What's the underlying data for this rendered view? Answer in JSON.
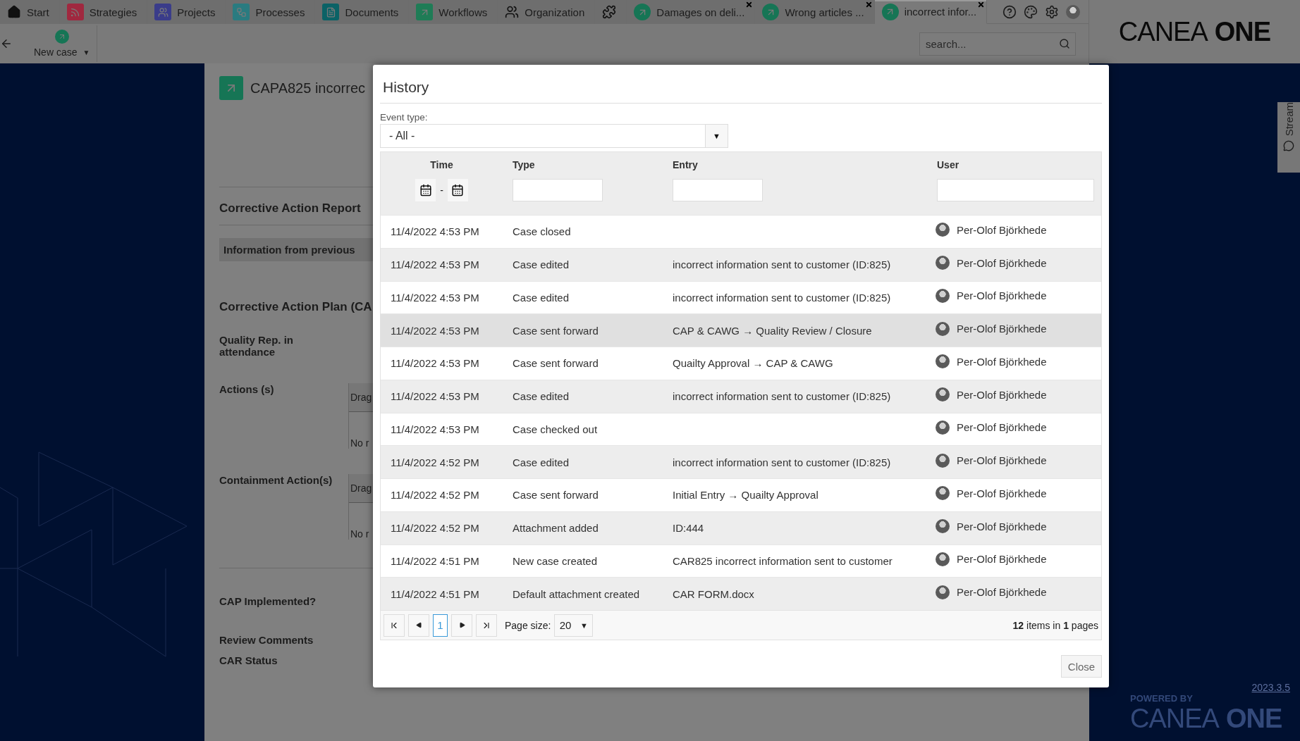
{
  "nav_tabs": [
    {
      "kind": "module",
      "label": "Start",
      "selected": false,
      "closable": false
    },
    {
      "kind": "module",
      "label": "Strategies",
      "selected": false,
      "closable": false
    },
    {
      "kind": "module",
      "label": "Projects",
      "selected": false,
      "closable": false
    },
    {
      "kind": "module",
      "label": "Processes",
      "selected": false,
      "closable": false
    },
    {
      "kind": "module",
      "label": "Documents",
      "selected": false,
      "closable": false
    },
    {
      "kind": "module",
      "label": "Workflows",
      "selected": false,
      "closable": false
    },
    {
      "kind": "module",
      "label": "Organization",
      "selected": false,
      "closable": false
    },
    {
      "kind": "icon",
      "selected": false,
      "closable": false
    },
    {
      "kind": "case",
      "label": "Damages on deli...",
      "selected": false,
      "closable": true
    },
    {
      "kind": "case",
      "label": "Wrong articles ...",
      "selected": false,
      "closable": true
    },
    {
      "kind": "case",
      "label": "incorrect infor...",
      "selected": true,
      "closable": true
    }
  ],
  "toolbar": {
    "new_case": "New case",
    "new_case_caret": "▼",
    "search": {
      "placeholder": "search..."
    }
  },
  "brand": {
    "logo_light": "CANEA",
    "logo_bold": "ONE"
  },
  "footer": {
    "version": "2023.3.5",
    "powered_by": "POWERED BY",
    "logo_light": "CANEA",
    "logo_bold": "ONE"
  },
  "stream_tab": "Stream",
  "case": {
    "title": "CAPA825 incorrec",
    "report_heading": "Corrective Action Report",
    "info_bar": "Information from previous",
    "plan_heading": "Corrective Action Plan (CA",
    "fields": [
      {
        "kind": "label",
        "label": "Quality Rep. in attendance"
      },
      {
        "kind": "grid",
        "label": "Actions (s)",
        "drag": "Drag",
        "empty": "No r"
      },
      {
        "kind": "grid",
        "label": "Containment Action(s)",
        "drag": "Drag",
        "empty": "No r"
      }
    ],
    "bottom_fields": [
      "CAP Implemented?",
      "Review Comments",
      "CAR Status"
    ]
  },
  "dialog": {
    "title": "History",
    "event_type_label": "Event type:",
    "event_type": "- All -",
    "event_type_caret": "▼",
    "columns": [
      "Time",
      "Type",
      "Entry",
      "User"
    ],
    "range_separator": "-",
    "rows": [
      {
        "time": "11/4/2022 4:53 PM",
        "type": "Case closed",
        "entry": "",
        "user": "Per-Olof Björkhede",
        "hovered": false
      },
      {
        "time": "11/4/2022 4:53 PM",
        "type": "Case edited",
        "entry": "incorrect information sent to customer (ID:825)",
        "user": "Per-Olof Björkhede",
        "hovered": false
      },
      {
        "time": "11/4/2022 4:53 PM",
        "type": "Case edited",
        "entry": "incorrect information sent to customer (ID:825)",
        "user": "Per-Olof Björkhede",
        "hovered": false
      },
      {
        "time": "11/4/2022 4:53 PM",
        "type": "Case sent forward",
        "entry": "CAP & CAWG → Quality Review / Closure",
        "user": "Per-Olof Björkhede",
        "hovered": true
      },
      {
        "time": "11/4/2022 4:53 PM",
        "type": "Case sent forward",
        "entry": "Quailty Approval → CAP & CAWG",
        "user": "Per-Olof Björkhede",
        "hovered": false
      },
      {
        "time": "11/4/2022 4:53 PM",
        "type": "Case edited",
        "entry": "incorrect information sent to customer (ID:825)",
        "user": "Per-Olof Björkhede",
        "hovered": false
      },
      {
        "time": "11/4/2022 4:53 PM",
        "type": "Case checked out",
        "entry": "",
        "user": "Per-Olof Björkhede",
        "hovered": false
      },
      {
        "time": "11/4/2022 4:52 PM",
        "type": "Case edited",
        "entry": "incorrect information sent to customer (ID:825)",
        "user": "Per-Olof Björkhede",
        "hovered": false
      },
      {
        "time": "11/4/2022 4:52 PM",
        "type": "Case sent forward",
        "entry": "Initial Entry → Quailty Approval",
        "user": "Per-Olof Björkhede",
        "hovered": false
      },
      {
        "time": "11/4/2022 4:52 PM",
        "type": "Attachment added",
        "entry": "ID:444",
        "user": "Per-Olof Björkhede",
        "hovered": false
      },
      {
        "time": "11/4/2022 4:51 PM",
        "type": "New case created",
        "entry": "CAR825 incorrect information sent to customer",
        "user": "Per-Olof Björkhede",
        "hovered": false
      },
      {
        "time": "11/4/2022 4:51 PM",
        "type": "Default attachment created",
        "entry": "CAR FORM.docx",
        "user": "Per-Olof Björkhede",
        "hovered": false
      }
    ],
    "pager": {
      "pages": [
        {
          "label": "1",
          "selected": true
        }
      ],
      "page_size_label": "Page size:",
      "page_size": "20",
      "page_size_caret": "▼",
      "summary": "**12** items in **1** pages"
    },
    "close": "Close"
  }
}
